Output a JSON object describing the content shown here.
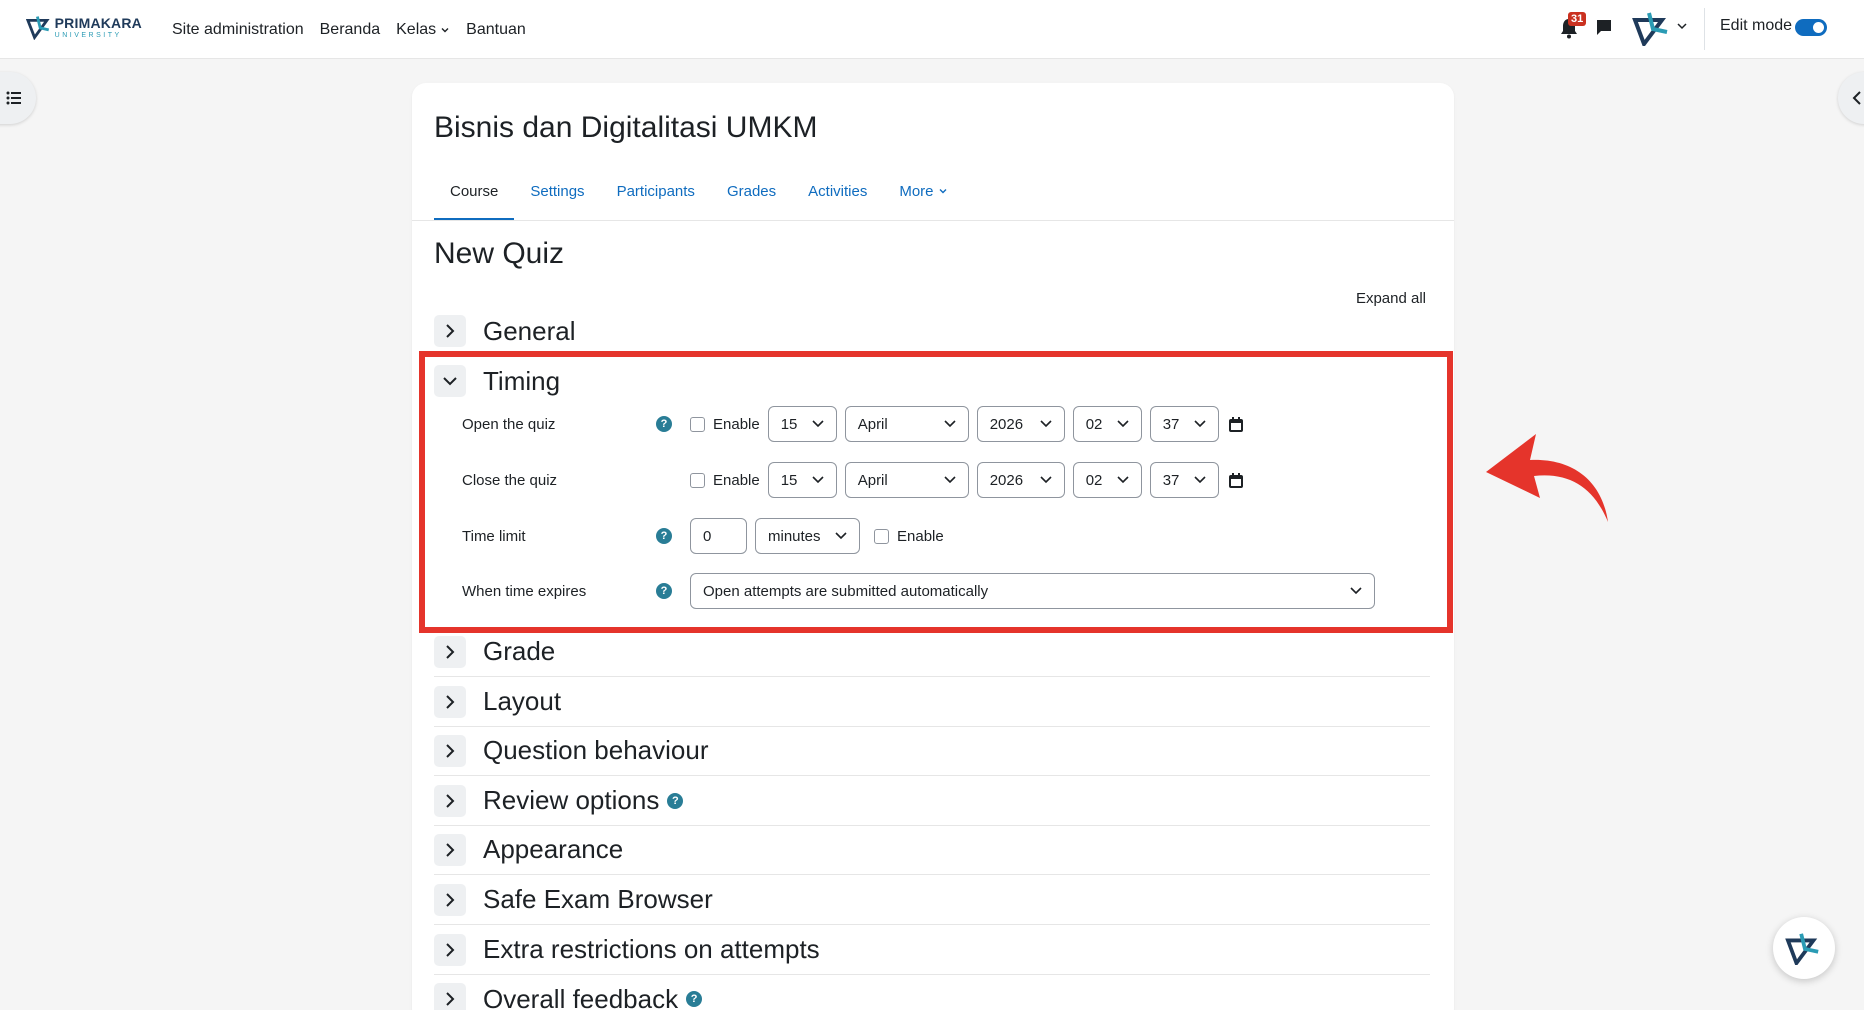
{
  "navbar": {
    "logo_main": "PRIMAKARA",
    "logo_sub": "UNIVERSITY",
    "links": [
      "Site administration",
      "Beranda",
      "Kelas",
      "Bantuan"
    ],
    "notification_count": "31",
    "edit_mode_label": "Edit mode"
  },
  "course": {
    "title": "Bisnis dan Digitalitasi UMKM",
    "tabs": [
      "Course",
      "Settings",
      "Participants",
      "Grades",
      "Activities",
      "More"
    ]
  },
  "page": {
    "heading": "New Quiz",
    "expand_all": "Expand all"
  },
  "sections": {
    "general": "General",
    "timing": "Timing",
    "grade": "Grade",
    "layout": "Layout",
    "question_behaviour": "Question behaviour",
    "review_options": "Review options",
    "appearance": "Appearance",
    "safe_exam_browser": "Safe Exam Browser",
    "extra_restrictions": "Extra restrictions on attempts",
    "overall_feedback": "Overall feedback"
  },
  "timing": {
    "open": {
      "label": "Open the quiz",
      "enable": "Enable",
      "day": "15",
      "month": "April",
      "year": "2026",
      "hour": "02",
      "minute": "37"
    },
    "close": {
      "label": "Close the quiz",
      "enable": "Enable",
      "day": "15",
      "month": "April",
      "year": "2026",
      "hour": "02",
      "minute": "37"
    },
    "time_limit": {
      "label": "Time limit",
      "value": "0",
      "unit": "minutes",
      "enable": "Enable"
    },
    "when_expires": {
      "label": "When time expires",
      "value": "Open attempts are submitted automatically"
    }
  },
  "help_glyph": "?",
  "colors": {
    "accent": "#0f6cbf",
    "highlight": "#e5342b",
    "help": "#297d96"
  }
}
